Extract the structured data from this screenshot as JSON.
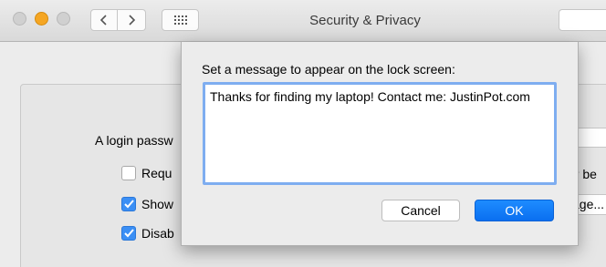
{
  "window": {
    "title": "Security & Privacy",
    "accent_color": "#0a6ff0"
  },
  "toolbar": {
    "back_icon": "chevron-left-icon",
    "forward_icon": "chevron-right-icon",
    "show_all_icon": "grid-icon"
  },
  "background": {
    "login_label": "A login passw",
    "checkboxes": [
      {
        "label": "Requ",
        "checked": false
      },
      {
        "label": "Show",
        "checked": true
      },
      {
        "label": "Disab",
        "checked": true
      }
    ],
    "right_fragment_text": "er be",
    "right_fragment_button": "age..."
  },
  "sheet": {
    "prompt": "Set a message to appear on the lock screen:",
    "message": "Thanks for finding my laptop! Contact me: JustinPot.com",
    "cancel_label": "Cancel",
    "ok_label": "OK"
  }
}
